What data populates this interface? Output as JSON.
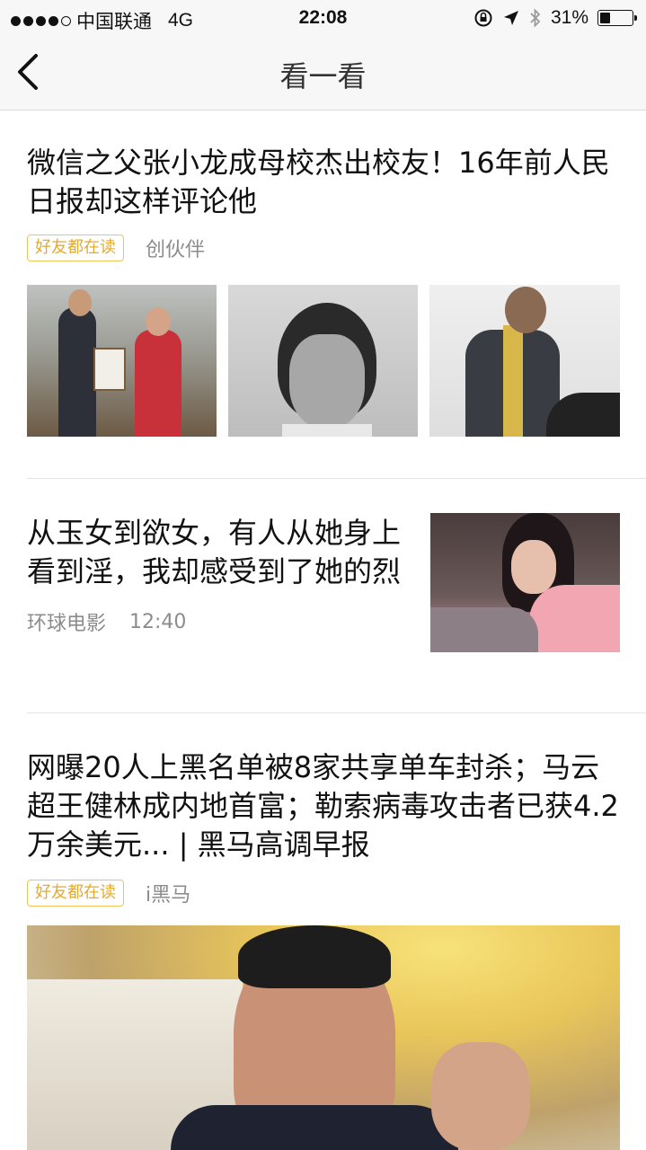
{
  "status": {
    "carrier": "中国联通",
    "network": "4G",
    "time": "22:08",
    "battery": "31%",
    "battery_level": 0.31
  },
  "nav": {
    "title": "看一看"
  },
  "articles": [
    {
      "title": "微信之父张小龙成母校杰出校友！16年前人民日报却这样评论他",
      "tag": "好友都在读",
      "source": "创伙伴"
    },
    {
      "title": "从玉女到欲女，有人从她身上看到淫，我却感受到了她的烈",
      "source": "环球电影",
      "time": "12:40"
    },
    {
      "title": "网曝20人上黑名单被8家共享单车封杀；马云超王健林成内地首富；勒索病毒攻击者已获4.2万余美元... | 黑马高调早报",
      "tag": "好友都在读",
      "source": "i黑马"
    }
  ],
  "colors": {
    "tag_border": "#f2c25a",
    "tag_text": "#e6a92b",
    "nav_bg": "#f7f7f7"
  }
}
